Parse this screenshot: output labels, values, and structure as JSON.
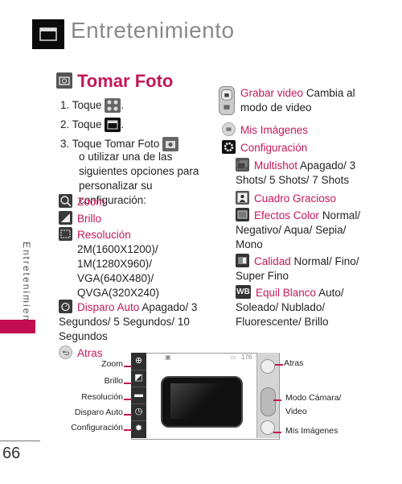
{
  "header": {
    "title": "Entretenimiento",
    "icon": "clapperboard-icon"
  },
  "side_tab": {
    "label": "Entretenimiento",
    "accent_color": "#c20d50"
  },
  "page_number": "66",
  "section": {
    "title": "Tomar Foto",
    "title_color": "#c2185b",
    "steps": [
      {
        "num": "1.",
        "text": "Toque",
        "icon": "apps-grid-icon",
        "after": "."
      },
      {
        "num": "2.",
        "text": "Toque",
        "icon": "clapperboard-icon",
        "after": "."
      },
      {
        "num": "3.",
        "text": "Toque",
        "bold": "Tomar Foto",
        "icon": "camera-icon",
        "after": "o utilizar una de las siguientes opciones para personalizar su configuración:"
      }
    ],
    "options_left": [
      {
        "label": "Zoom",
        "desc": "",
        "icon": "zoom-icon"
      },
      {
        "label": "Brillo",
        "desc": "",
        "icon": "brightness-icon"
      },
      {
        "label": "Resolución",
        "desc": "",
        "icon": "resolution-icon",
        "sub": [
          "2M(1600X1200)/",
          "1M(1280X960)/",
          "VGA(640X480)/",
          "QVGA(320X240)"
        ]
      },
      {
        "label": "Disparo Auto",
        "desc": "Apagado/ 3 Segundos/ 5 Segundos/ 10 Segundos",
        "icon": "timer-icon"
      },
      {
        "label": "Atras",
        "desc": "",
        "icon": "back-icon"
      }
    ],
    "options_right": [
      {
        "label": "Grabar video",
        "desc": "Cambia al modo de video",
        "icon": "camera-video-switch-icon"
      },
      {
        "label": "Mis Imágenes",
        "desc": "",
        "icon": "gallery-icon"
      },
      {
        "label": "Configuración",
        "desc": "",
        "icon": "gear-icon"
      }
    ],
    "config_items": [
      {
        "label": "Multishot",
        "desc": "Apagado/ 3 Shots/ 5 Shots/ 7 Shots",
        "icon": "multishot-icon"
      },
      {
        "label": "Cuadro Gracioso",
        "desc": "",
        "icon": "frame-icon"
      },
      {
        "label": "Efectos Color",
        "desc": "Normal/ Negativo/ Aqua/ Sepia/ Mono",
        "icon": "color-effects-icon"
      },
      {
        "label": "Calidad",
        "desc": "Normal/ Fino/ Super Fino",
        "icon": "quality-icon"
      },
      {
        "label": "Equil Blanco",
        "desc": "Auto/ Soleado/ Nublado/ Fluorescente/ Brillo",
        "icon": "white-balance-icon",
        "glyph": "WB"
      }
    ]
  },
  "diagram": {
    "left_callouts": [
      "Zoom",
      "Brillo",
      "Resolución",
      "Disparo Auto",
      "Configuración"
    ],
    "right_callouts": [
      "Atras",
      "Modo Cámara/",
      "Video",
      "Mis Imágenes"
    ],
    "status_count": "176"
  }
}
